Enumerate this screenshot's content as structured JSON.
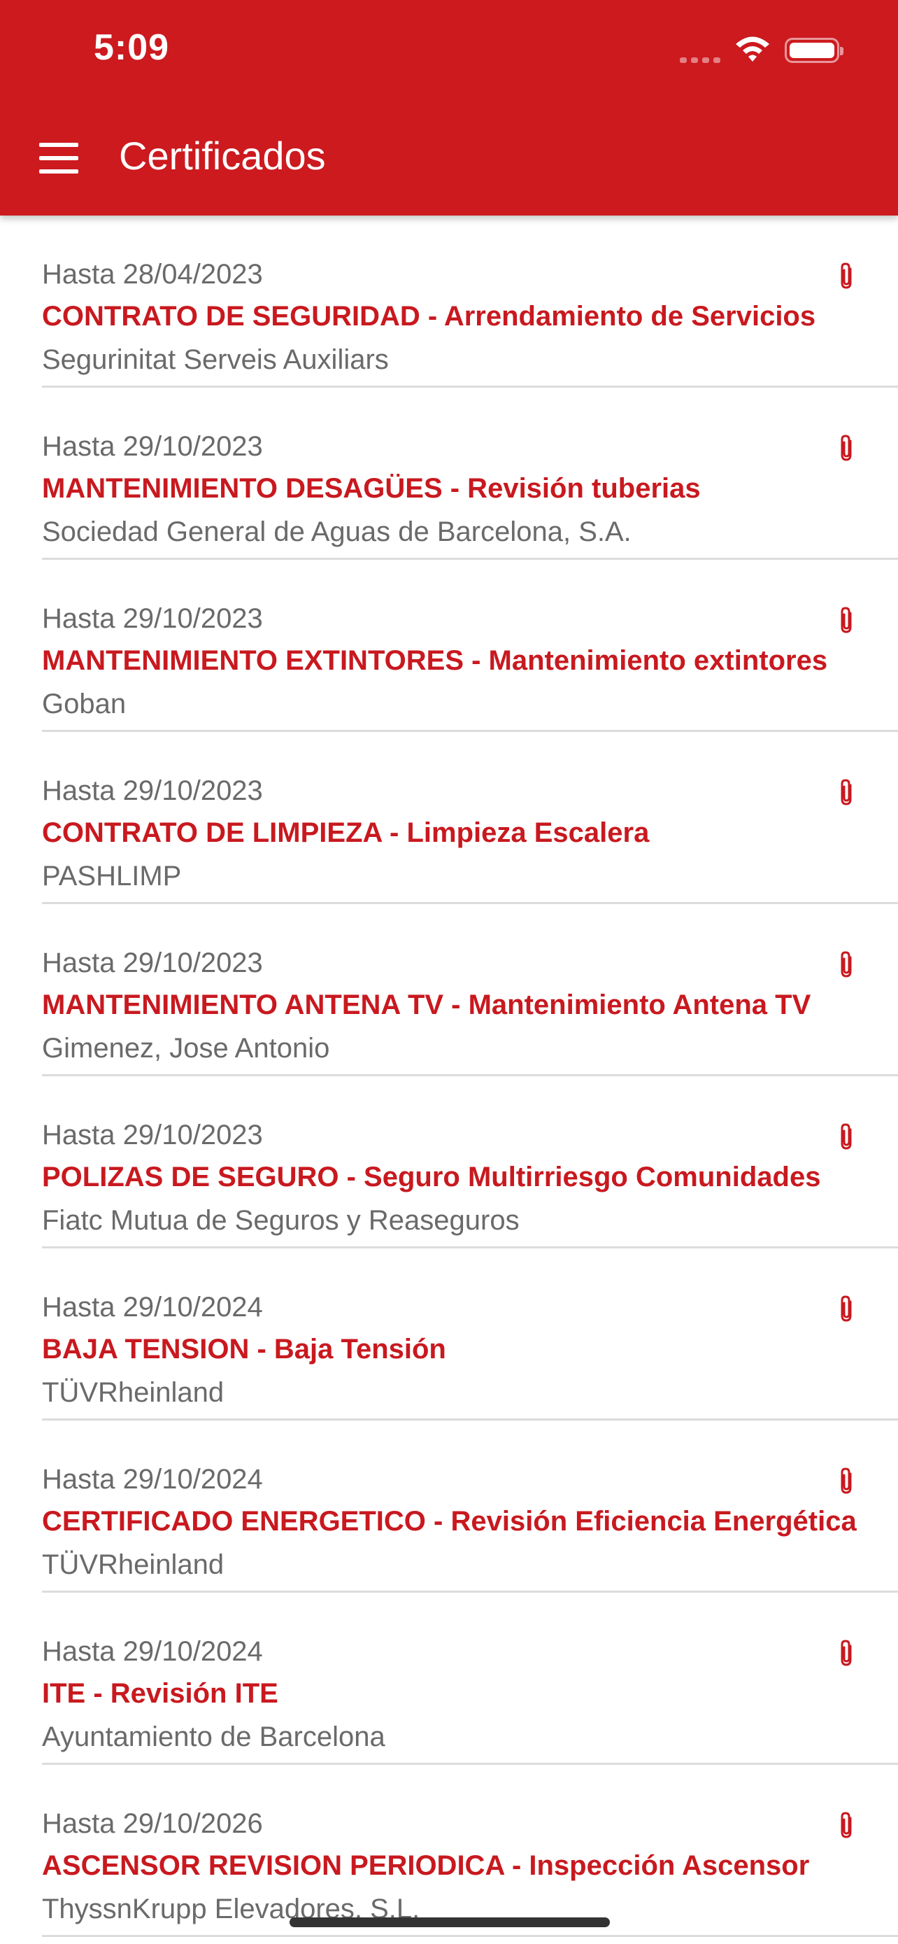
{
  "status_bar": {
    "time": "5:09",
    "icons": [
      "cellular-signal-icon",
      "wifi-icon",
      "battery-icon"
    ]
  },
  "header": {
    "title": "Certificados",
    "menu_icon": "hamburger-menu-icon",
    "background_color": "#cc1a1f"
  },
  "colors": {
    "accent": "#c8191f",
    "secondary_text": "#6a6a6a",
    "divider": "#dcdcdc"
  },
  "certificates": [
    {
      "date": "Hasta 28/04/2023",
      "title": "CONTRATO DE SEGURIDAD - Arrendamiento de Servicios",
      "company": "Segurinitat Serveis Auxiliars",
      "icon": "paperclip-icon"
    },
    {
      "date": "Hasta 29/10/2023",
      "title": "MANTENIMIENTO DESAGÜES - Revisión tuberias",
      "company": "Sociedad General de Aguas de Barcelona, S.A.",
      "icon": "paperclip-icon"
    },
    {
      "date": "Hasta 29/10/2023",
      "title": "MANTENIMIENTO EXTINTORES - Mantenimiento extintores",
      "company": "Goban",
      "icon": "paperclip-icon"
    },
    {
      "date": "Hasta 29/10/2023",
      "title": "CONTRATO DE LIMPIEZA - Limpieza Escalera",
      "company": "PASHLIMP",
      "icon": "paperclip-icon"
    },
    {
      "date": "Hasta 29/10/2023",
      "title": "MANTENIMIENTO ANTENA TV - Mantenimiento Antena TV",
      "company": "Gimenez, Jose Antonio",
      "icon": "paperclip-icon"
    },
    {
      "date": "Hasta 29/10/2023",
      "title": "POLIZAS DE SEGURO - Seguro Multirriesgo Comunidades",
      "company": "Fiatc Mutua de Seguros y Reaseguros",
      "icon": "paperclip-icon"
    },
    {
      "date": "Hasta 29/10/2024",
      "title": "BAJA TENSION - Baja Tensión",
      "company": "TÜVRheinland",
      "icon": "paperclip-icon"
    },
    {
      "date": "Hasta 29/10/2024",
      "title": "CERTIFICADO ENERGETICO - Revisión Eficiencia Energética",
      "company": "TÜVRheinland",
      "icon": "paperclip-icon"
    },
    {
      "date": "Hasta 29/10/2024",
      "title": "ITE - Revisión ITE",
      "company": "Ayuntamiento de Barcelona",
      "icon": "paperclip-icon"
    },
    {
      "date": "Hasta 29/10/2026",
      "title": "ASCENSOR REVISION PERIODICA - Inspección Ascensor",
      "company": "ThyssnKrupp Elevadores, S.L.",
      "icon": "paperclip-icon"
    }
  ]
}
